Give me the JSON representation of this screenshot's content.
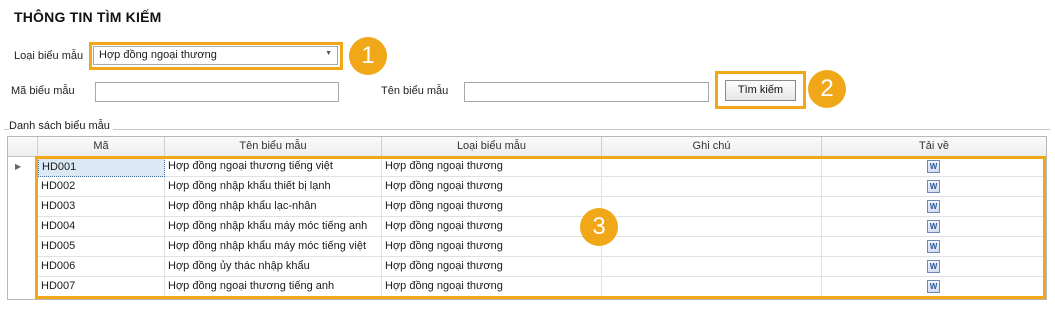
{
  "page": {
    "title": "THÔNG TIN TÌM KIẾM"
  },
  "search": {
    "type_label": "Loại biểu mẫu",
    "type_value": "Hợp đồng ngoại thương",
    "code_label": "Mã biểu mẫu",
    "code_value": "",
    "name_label": "Tên biểu mẫu",
    "name_value": "",
    "search_button": "Tìm kiếm"
  },
  "annotations": [
    "1",
    "2",
    "3"
  ],
  "list": {
    "group_title": "Danh sách biểu mẫu",
    "columns": [
      "Mã",
      "Tên biểu mẫu",
      "Loại biểu mẫu",
      "Ghi chú",
      "Tải về"
    ],
    "rows": [
      {
        "code": "HD001",
        "name": "Hợp đồng ngoại thương tiếng việt",
        "type": "Hợp đồng ngoại thương",
        "note": ""
      },
      {
        "code": "HD002",
        "name": "Hợp đồng nhập khẩu thiết bị lạnh",
        "type": "Hợp đồng ngoại thương",
        "note": ""
      },
      {
        "code": "HD003",
        "name": "Hợp đồng nhập khẩu lạc-nhân",
        "type": "Hợp đồng ngoại thương",
        "note": ""
      },
      {
        "code": "HD004",
        "name": "Hợp đồng nhập khẩu máy móc tiếng anh",
        "type": "Hợp đồng ngoại thương",
        "note": ""
      },
      {
        "code": "HD005",
        "name": "Hợp đồng nhập khẩu máy móc tiếng việt",
        "type": "Hợp đồng ngoại thương",
        "note": ""
      },
      {
        "code": "HD006",
        "name": "Hợp đồng ủy thác nhập khẩu",
        "type": "Hợp đồng ngoại thương",
        "note": ""
      },
      {
        "code": "HD007",
        "name": "Hợp đồng ngoại thương tiếng anh",
        "type": "Hợp đồng ngoại thương",
        "note": ""
      }
    ],
    "download_icon": "word-document-icon"
  },
  "colors": {
    "highlight": "#f0a818",
    "selection": "#dde8f5"
  }
}
